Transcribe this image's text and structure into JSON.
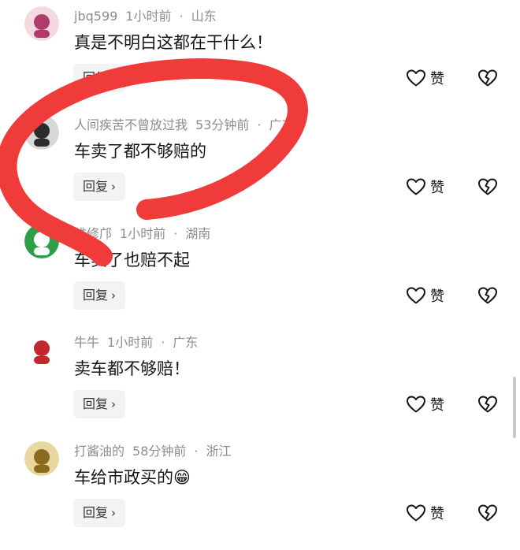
{
  "comments": [
    {
      "user": "jbq599",
      "time": "1小时前",
      "location": "山东",
      "text": "真是不明白这都在干什么！",
      "avatar_color": "#b03a6b",
      "avatar_bg": "#f4d9e1"
    },
    {
      "user": "人间疾苦不曾放过我",
      "time": "53分钟前",
      "location": "广东",
      "text": "车卖了都不够赔的",
      "avatar_color": "#2c2c2c",
      "avatar_bg": "#d8d8d8"
    },
    {
      "user": "维修邝",
      "time": "1小时前",
      "location": "湖南",
      "text": "车卖了也赔不起",
      "avatar_color": "#ffffff",
      "avatar_bg": "#2e9e48"
    },
    {
      "user": "牛牛",
      "time": "1小时前",
      "location": "广东",
      "text": "卖车都不够赔！",
      "avatar_color": "#c0282d",
      "avatar_bg": "#ffffff"
    },
    {
      "user": "打酱油的",
      "time": "58分钟前",
      "location": "浙江",
      "text": "车给市政买的",
      "avatar_color": "#8a6a1c",
      "avatar_bg": "#e8d8a0",
      "emoji": "😁"
    }
  ],
  "actions": {
    "reply_label": "回复",
    "chevron": "›",
    "like_label": "赞"
  },
  "annotation": {
    "color": "#f03b3b"
  },
  "icons": {
    "like": "heart-outline-icon",
    "dislike": "broken-heart-icon",
    "reply": "chevron-right-icon"
  }
}
